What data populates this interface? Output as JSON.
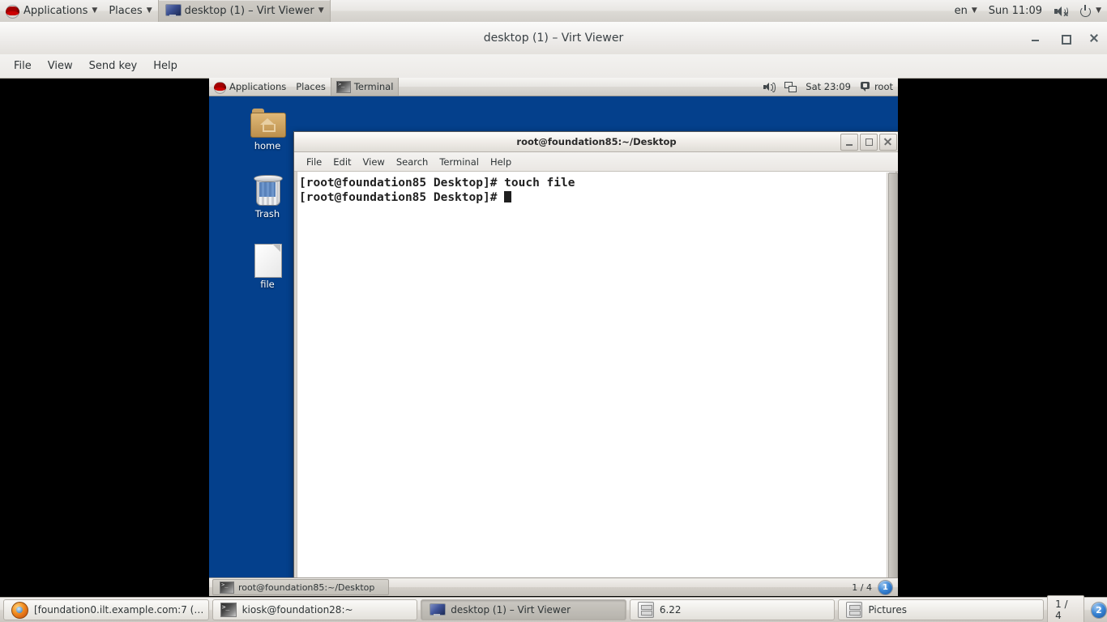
{
  "host_panel": {
    "applications_label": "Applications",
    "places_label": "Places",
    "active_window_label": "desktop (1) – Virt Viewer",
    "keyboard_layout": "en",
    "clock": "Sun 11:09",
    "icons": {
      "menu_logo": "redhat-logo-icon",
      "window_icon": "monitor-icon",
      "volume": "volume-muted-icon",
      "power": "power-icon"
    }
  },
  "virt_viewer": {
    "title": "desktop (1) – Virt Viewer",
    "menus": [
      "File",
      "View",
      "Send key",
      "Help"
    ],
    "window_buttons": [
      "minimize",
      "maximize",
      "close"
    ]
  },
  "vm": {
    "panel": {
      "applications_label": "Applications",
      "places_label": "Places",
      "active_window_label": "Terminal",
      "clock": "Sat 23:09",
      "user": "root"
    },
    "desktop_icons": [
      {
        "name": "home",
        "label": "home"
      },
      {
        "name": "trash",
        "label": "Trash"
      },
      {
        "name": "file",
        "label": "file"
      }
    ],
    "terminal": {
      "title": "root@foundation85:~/Desktop",
      "menus": [
        "File",
        "Edit",
        "View",
        "Search",
        "Terminal",
        "Help"
      ],
      "lines": [
        "[root@foundation85 Desktop]# touch file",
        "[root@foundation85 Desktop]# "
      ]
    },
    "taskbar": {
      "window_label": "root@foundation85:~/Desktop",
      "workspace": "1 / 4",
      "workspace_badge": "1"
    },
    "background_color": "#04408c"
  },
  "host_taskbar": {
    "items": [
      {
        "label": "[foundation0.ilt.example.com:7 (…",
        "icon": "firefox-icon",
        "selected": false
      },
      {
        "label": "kiosk@foundation28:~",
        "icon": "terminal-icon",
        "selected": false
      },
      {
        "label": "desktop (1) – Virt Viewer",
        "icon": "monitor-icon",
        "selected": true
      },
      {
        "label": "6.22",
        "icon": "archive-icon",
        "selected": false
      },
      {
        "label": "Pictures",
        "icon": "archive-icon",
        "selected": false
      }
    ],
    "workspace": "1 / 4",
    "workspace_badge": "2"
  }
}
